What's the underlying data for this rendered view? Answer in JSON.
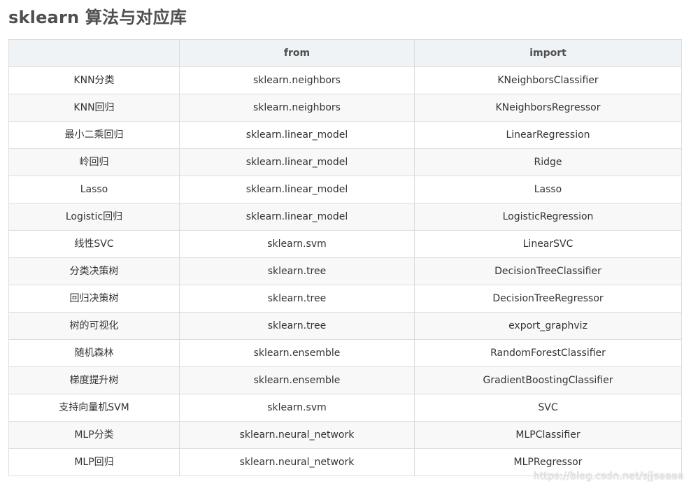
{
  "title": "sklearn 算法与对应库",
  "table": {
    "headers": [
      "",
      "from",
      "import"
    ],
    "rows": [
      [
        "KNN分类",
        "sklearn.neighbors",
        "KNeighborsClassifier"
      ],
      [
        "KNN回归",
        "sklearn.neighbors",
        "KNeighborsRegressor"
      ],
      [
        "最小二乘回归",
        "sklearn.linear_model",
        "LinearRegression"
      ],
      [
        "岭回归",
        "sklearn.linear_model",
        "Ridge"
      ],
      [
        "Lasso",
        "sklearn.linear_model",
        "Lasso"
      ],
      [
        "Logistic回归",
        "sklearn.linear_model",
        "LogisticRegression"
      ],
      [
        "线性SVC",
        "sklearn.svm",
        "LinearSVC"
      ],
      [
        "分类决策树",
        "sklearn.tree",
        "DecisionTreeClassifier"
      ],
      [
        "回归决策树",
        "sklearn.tree",
        "DecisionTreeRegressor"
      ],
      [
        "树的可视化",
        "sklearn.tree",
        "export_graphviz"
      ],
      [
        "随机森林",
        "sklearn.ensemble",
        "RandomForestClassifier"
      ],
      [
        "梯度提升树",
        "sklearn.ensemble",
        "GradientBoostingClassifier"
      ],
      [
        "支持向量机SVM",
        "sklearn.svm",
        "SVC"
      ],
      [
        "MLP分类",
        "sklearn.neural_network",
        "MLPClassifier"
      ],
      [
        "MLP回归",
        "sklearn.neural_network",
        "MLPRegressor"
      ]
    ]
  },
  "watermark": "https://blog.csdn.net/sjjsaaaa"
}
